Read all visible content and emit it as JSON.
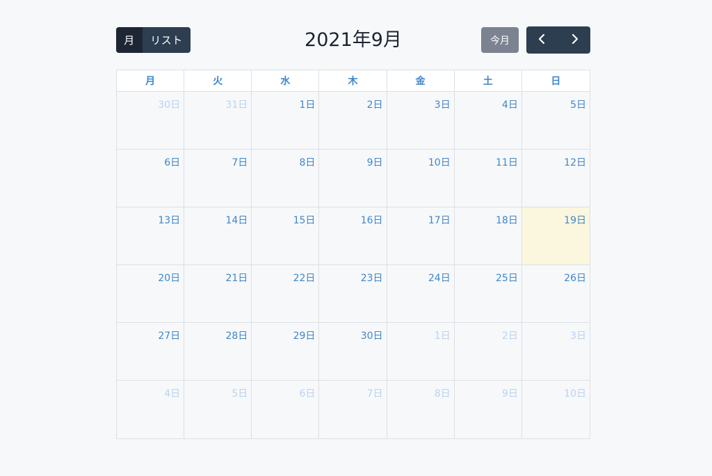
{
  "toolbar": {
    "view_month_label": "月",
    "view_list_label": "リスト",
    "title": "2021年9月",
    "today_label": "今月"
  },
  "weekdays": [
    "月",
    "火",
    "水",
    "木",
    "金",
    "土",
    "日"
  ],
  "weeks": [
    [
      {
        "label": "30日",
        "other": true
      },
      {
        "label": "31日",
        "other": true
      },
      {
        "label": "1日"
      },
      {
        "label": "2日"
      },
      {
        "label": "3日"
      },
      {
        "label": "4日"
      },
      {
        "label": "5日"
      }
    ],
    [
      {
        "label": "6日"
      },
      {
        "label": "7日"
      },
      {
        "label": "8日"
      },
      {
        "label": "9日"
      },
      {
        "label": "10日"
      },
      {
        "label": "11日"
      },
      {
        "label": "12日"
      }
    ],
    [
      {
        "label": "13日"
      },
      {
        "label": "14日"
      },
      {
        "label": "15日"
      },
      {
        "label": "16日"
      },
      {
        "label": "17日"
      },
      {
        "label": "18日"
      },
      {
        "label": "19日",
        "today": true
      }
    ],
    [
      {
        "label": "20日"
      },
      {
        "label": "21日"
      },
      {
        "label": "22日"
      },
      {
        "label": "23日"
      },
      {
        "label": "24日"
      },
      {
        "label": "25日"
      },
      {
        "label": "26日"
      }
    ],
    [
      {
        "label": "27日"
      },
      {
        "label": "28日"
      },
      {
        "label": "29日"
      },
      {
        "label": "30日"
      },
      {
        "label": "1日",
        "other": true
      },
      {
        "label": "2日",
        "other": true
      },
      {
        "label": "3日",
        "other": true
      }
    ],
    [
      {
        "label": "4日",
        "other": true
      },
      {
        "label": "5日",
        "other": true
      },
      {
        "label": "6日",
        "other": true
      },
      {
        "label": "7日",
        "other": true
      },
      {
        "label": "8日",
        "other": true
      },
      {
        "label": "9日",
        "other": true
      },
      {
        "label": "10日",
        "other": true
      }
    ]
  ],
  "icons": {
    "prev": "chevron-left-icon",
    "next": "chevron-right-icon"
  },
  "colors": {
    "accent": "#3f86c9",
    "other_month": "#b9d3ee",
    "today_bg": "#fbf6de",
    "button_dark": "#2c3e50",
    "button_active": "#1e2633",
    "button_gray": "#7b8390"
  }
}
